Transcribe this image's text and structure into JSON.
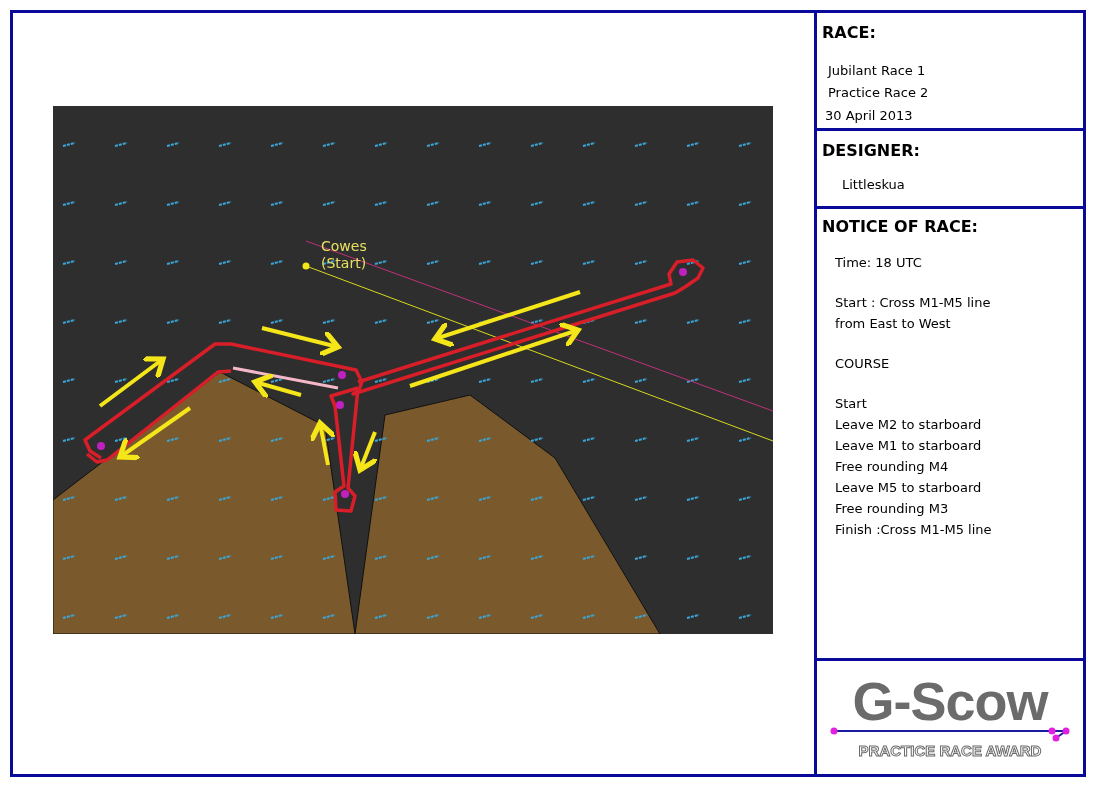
{
  "map": {
    "labels": [
      "Cowes",
      "(Start)"
    ]
  },
  "race": {
    "heading": "RACE:",
    "lines": [
      "Jubilant Race 1",
      "Practice Race 2"
    ],
    "date": "30 April 2013"
  },
  "designer": {
    "heading": "DESIGNER:",
    "name": "Littleskua"
  },
  "notice": {
    "heading": "NOTICE OF RACE:",
    "blocks": [
      {
        "lines": [
          "Time: 18 UTC"
        ]
      },
      {
        "lines": [
          "Start : Cross M1-M5 line",
          "from East to West"
        ]
      },
      {
        "lines": [
          "COURSE"
        ]
      },
      {
        "lines": [
          "Start",
          "Leave M2 to starboard",
          "Leave M1 to starboard",
          "Free rounding M4",
          "Leave M5 to starboard",
          "Free rounding M3",
          "Finish :Cross M1-M5 line"
        ]
      }
    ]
  },
  "logo": {
    "title": "G-Scow",
    "subtitle": "PRACTICE RACE AWARD"
  }
}
